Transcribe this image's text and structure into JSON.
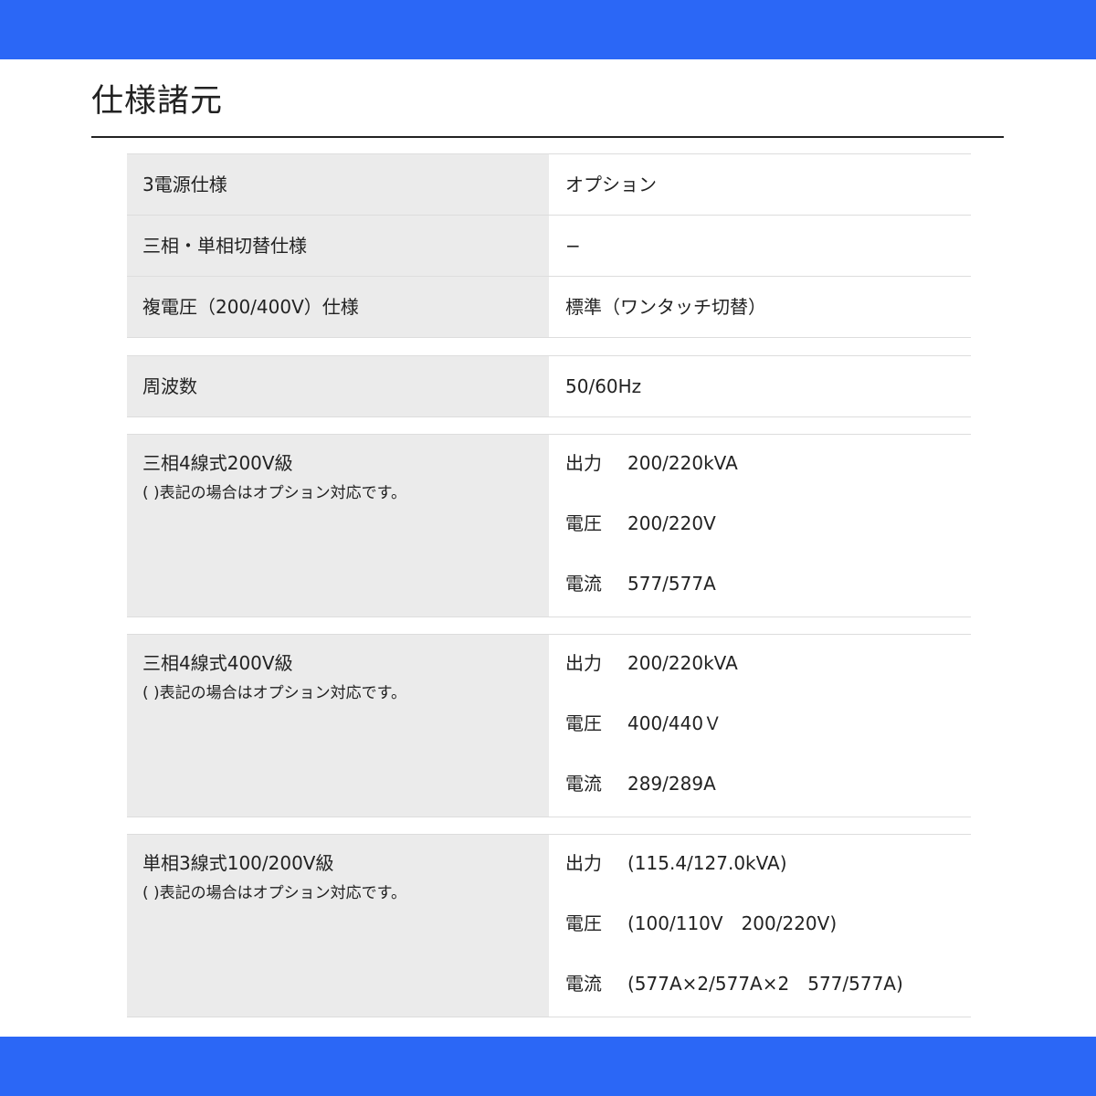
{
  "title": "仕様諸元",
  "specs": {
    "group1": [
      {
        "label": "3電源仕様",
        "value": "オプション"
      },
      {
        "label": "三相・単相切替仕様",
        "value": "−"
      },
      {
        "label": "複電圧（200/400V）仕様",
        "value": "標準（ワンタッチ切替）"
      }
    ],
    "group2": [
      {
        "label": "周波数",
        "value": "50/60Hz"
      }
    ],
    "group3": {
      "label": "三相4線式200V級",
      "note": "( )表記の場合はオプション対応です。",
      "lines": [
        {
          "key": "出力",
          "value": "200/220kVA"
        },
        {
          "key": "電圧",
          "value": "200/220V"
        },
        {
          "key": "電流",
          "value": "577/577A"
        }
      ]
    },
    "group4": {
      "label": "三相4線式400V級",
      "note": "( )表記の場合はオプション対応です。",
      "lines": [
        {
          "key": "出力",
          "value": "200/220kVA"
        },
        {
          "key": "電圧",
          "value": "400/440Ｖ"
        },
        {
          "key": "電流",
          "value": "289/289A"
        }
      ]
    },
    "group5": {
      "label": "単相3線式100/200V級",
      "note": "( )表記の場合はオプション対応です。",
      "lines": [
        {
          "key": "出力",
          "value": "(115.4/127.0kVA)"
        },
        {
          "key": "電圧",
          "value": "(100/110V　200/220V)"
        },
        {
          "key": "電流",
          "value": "(577A×2/577A×2　577/577A)"
        }
      ]
    }
  }
}
